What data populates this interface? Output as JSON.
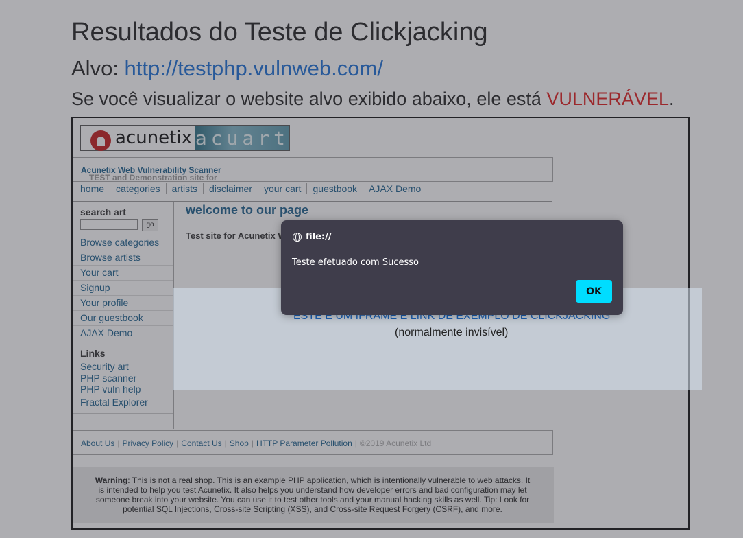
{
  "page": {
    "title": "Resultados do Teste de Clickjacking",
    "target_label": "Alvo:",
    "target_url": "http://testphp.vulnweb.com/",
    "note_prefix": "Se você visualizar o website alvo exibido abaixo, ele está ",
    "note_vuln": "VULNERÁVEL",
    "note_suffix": "."
  },
  "iframe": {
    "logo_left": "acunetix",
    "logo_right": "acuart",
    "tagline_prefix": "TEST and Demonstration site for ",
    "tagline_link": "Acunetix Web Vulnerability Scanner",
    "menu": [
      "home",
      "categories",
      "artists",
      "disclaimer",
      "your cart",
      "guestbook",
      "AJAX Demo"
    ],
    "search_heading": "search art",
    "search_button": "go",
    "side_links": [
      "Browse categories",
      "Browse artists",
      "Your cart",
      "Signup",
      "Your profile",
      "Our guestbook",
      "AJAX Demo"
    ],
    "links_heading": "Links",
    "external_links": [
      "Security art",
      "PHP scanner",
      "PHP vuln help",
      "Fractal Explorer"
    ],
    "welcome": "welcome to our page",
    "test_site_text": "Test site for Acunetix W",
    "footer_links": [
      "About Us",
      "Privacy Policy",
      "Contact Us",
      "Shop",
      "HTTP Parameter Pollution"
    ],
    "copyright": "©2019 Acunetix Ltd",
    "warning_bold": "Warning",
    "warning_text": ": This is not a real shop. This is an example PHP application, which is intentionally vulnerable to web attacks. It is intended to help you test Acunetix. It also helps you understand how developer errors and bad configuration may let someone break into your website. You can use it to test other tools and your manual hacking skills as well. Tip: Look for potential SQL Injections, Cross-site Scripting (XSS), and Cross-site Request Forgery (CSRF), and more."
  },
  "clickjack_link": {
    "text": "ESTE É UM IFRAME E LINK DE EXEMPLO DE CLICKJACKING",
    "subtext": "(normalmente invisível)"
  },
  "dialog": {
    "origin": "file://",
    "message": "Teste efetuado com Sucesso",
    "ok_label": "OK"
  },
  "colors": {
    "vulnerable": "#e01b1b",
    "link": "#1a6fd6",
    "dialog_bg": "#3f3d4b",
    "ok_button": "#00ddff"
  }
}
